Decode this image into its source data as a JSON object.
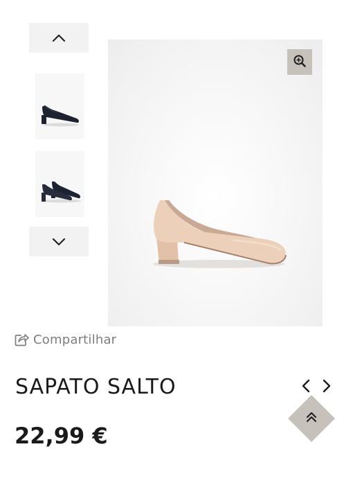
{
  "gallery": {
    "scroll_up_icon": "chevron-up-icon",
    "scroll_down_icon": "chevron-down-icon",
    "thumbnails": [
      {
        "depicts": "black-pump-single",
        "selected": false
      },
      {
        "depicts": "black-pump-pair",
        "selected": false
      }
    ],
    "main_image": {
      "depicts": "nude-pump-side-view"
    },
    "zoom_icon": "zoom-in-icon"
  },
  "share": {
    "label": "Compartilhar",
    "icon": "share-icon"
  },
  "product": {
    "title": "SAPATO SALTO",
    "price": "22,99 €"
  },
  "navigation": {
    "prev_icon": "chevron-left-icon",
    "next_icon": "chevron-right-icon"
  },
  "back_to_top": {
    "icon": "double-chevron-up-icon"
  },
  "colors": {
    "accent": "#c6c2bb",
    "arrow_bg": "#f2f2f2",
    "text": "#1a1a1a",
    "muted": "#7d7d7d",
    "shoe_nude": "#e8c8b0"
  }
}
